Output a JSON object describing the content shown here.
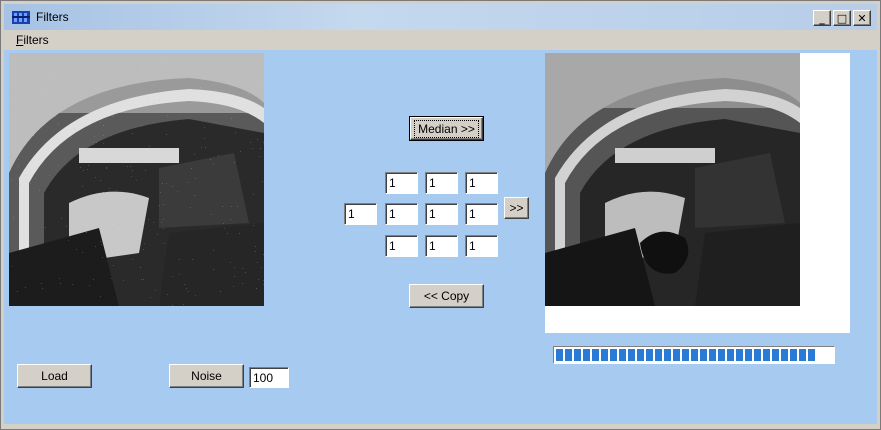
{
  "window": {
    "title": "Filters",
    "title_icon": "app-filter-icon"
  },
  "titlebar_buttons": {
    "minimize": "_",
    "maximize": "□",
    "close": "✕"
  },
  "menu": {
    "first_letter": "F",
    "rest": "ilters"
  },
  "buttons": {
    "median": "Median >>",
    "copy": "<< Copy",
    "apply": ">>",
    "load": "Load",
    "noise": "Noise"
  },
  "kernel": {
    "rows": [
      [
        "1",
        "1",
        "1"
      ],
      [
        "1",
        "1",
        "1"
      ],
      [
        "1",
        "1",
        "1"
      ]
    ],
    "divisor": "1"
  },
  "noise_value": "100",
  "progress": {
    "fraction": 1.0,
    "segments": 29
  },
  "colors": {
    "client_bg": "#a6caf0",
    "progress": "#2a7bd6"
  }
}
